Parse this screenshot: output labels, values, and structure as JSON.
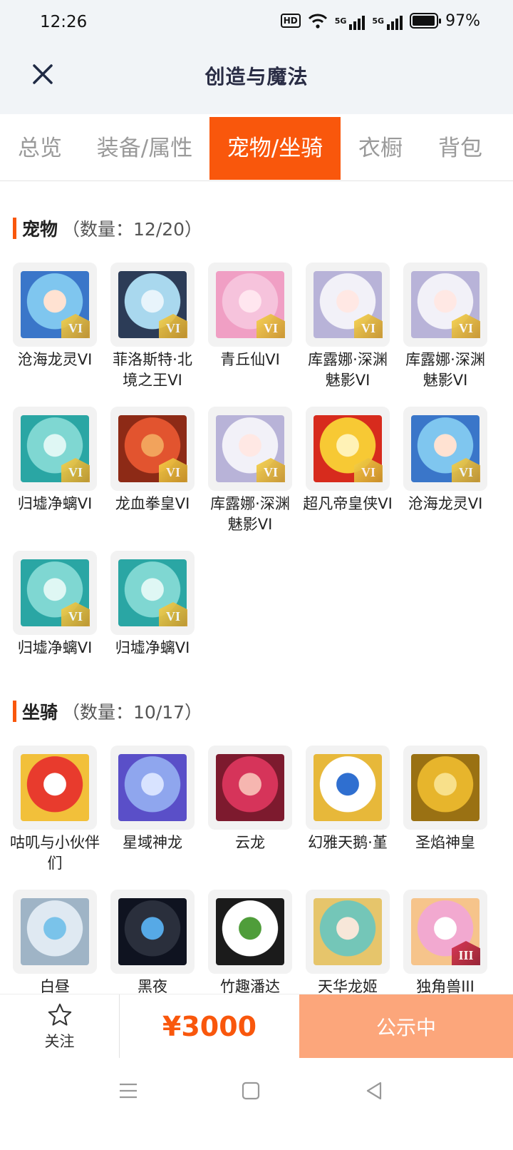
{
  "status_bar": {
    "time": "12:26",
    "battery": "97%",
    "battery_level": 0.97,
    "net_1": "5G",
    "net_2": "5G",
    "hd": "HD"
  },
  "header": {
    "title": "创造与魔法"
  },
  "tabs": [
    {
      "label": "总览",
      "active": false
    },
    {
      "label": "装备/属性",
      "active": false
    },
    {
      "label": "宠物/坐骑",
      "active": true
    },
    {
      "label": "衣橱",
      "active": false
    },
    {
      "label": "背包",
      "active": false
    }
  ],
  "pets": {
    "title": "宠物",
    "count": "（数量：12/20）",
    "items": [
      {
        "name": "沧海龙灵VI",
        "icon": "blue-dragon-girl",
        "badge": "VI"
      },
      {
        "name": "菲洛斯特·北境之王VI",
        "icon": "ice-king",
        "badge": "VI"
      },
      {
        "name": "青丘仙VI",
        "icon": "fox-fairy",
        "badge": "VI"
      },
      {
        "name": "库露娜·深渊魅影VI",
        "icon": "white-hair-girl",
        "badge": "VI"
      },
      {
        "name": "库露娜·深渊魅影VI",
        "icon": "white-hair-girl",
        "badge": "VI"
      },
      {
        "name": "归墟净螭VI",
        "icon": "teal-dragon",
        "badge": "VI"
      },
      {
        "name": "龙血拳皇VI",
        "icon": "red-ram-beast",
        "badge": "VI"
      },
      {
        "name": "库露娜·深渊魅影VI",
        "icon": "white-hair-girl",
        "badge": "VI"
      },
      {
        "name": "超凡帝皇侠VI",
        "icon": "golden-armor",
        "badge": "VI"
      },
      {
        "name": "沧海龙灵VI",
        "icon": "blue-dragon-girl",
        "badge": "VI"
      },
      {
        "name": "归墟净螭VI",
        "icon": "teal-dragon",
        "badge": "VI"
      },
      {
        "name": "归墟净螭VI",
        "icon": "teal-dragon",
        "badge": "VI"
      }
    ]
  },
  "mounts": {
    "title": "坐骑",
    "count": "（数量：10/17）",
    "items": [
      {
        "name": "咕叽与小伙伴们",
        "icon": "clown-bunny"
      },
      {
        "name": "星域神龙",
        "icon": "blue-star-dragon"
      },
      {
        "name": "云龙",
        "icon": "crimson-dragon"
      },
      {
        "name": "幻雅天鹅·堇",
        "icon": "white-swan"
      },
      {
        "name": "圣焰神皇",
        "icon": "golden-dragon"
      },
      {
        "name": "白昼",
        "icon": "white-dragon"
      },
      {
        "name": "黑夜",
        "icon": "black-dragon"
      },
      {
        "name": "竹趣潘达",
        "icon": "panda"
      },
      {
        "name": "天华龙姬",
        "icon": "dragon-princess"
      },
      {
        "name": "独角兽III",
        "icon": "unicorn",
        "badge": "III"
      }
    ]
  },
  "footer": {
    "follow_label": "关注",
    "price": "¥3000",
    "status_label": "公示中"
  },
  "colors": {
    "accent": "#f9570c",
    "status_button": "#fca67b",
    "title_text": "#2a2d45"
  }
}
